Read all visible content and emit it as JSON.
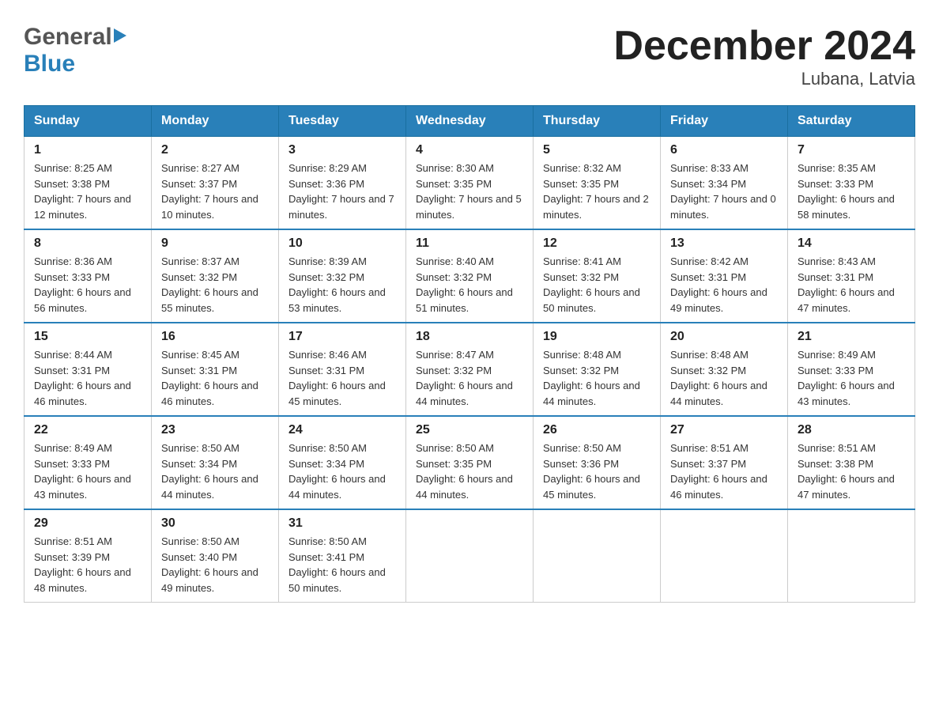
{
  "header": {
    "logo_general": "General",
    "logo_blue": "Blue",
    "title": "December 2024",
    "subtitle": "Lubana, Latvia"
  },
  "calendar": {
    "days_of_week": [
      "Sunday",
      "Monday",
      "Tuesday",
      "Wednesday",
      "Thursday",
      "Friday",
      "Saturday"
    ],
    "weeks": [
      [
        {
          "day": "1",
          "sunrise": "8:25 AM",
          "sunset": "3:38 PM",
          "daylight": "7 hours and 12 minutes."
        },
        {
          "day": "2",
          "sunrise": "8:27 AM",
          "sunset": "3:37 PM",
          "daylight": "7 hours and 10 minutes."
        },
        {
          "day": "3",
          "sunrise": "8:29 AM",
          "sunset": "3:36 PM",
          "daylight": "7 hours and 7 minutes."
        },
        {
          "day": "4",
          "sunrise": "8:30 AM",
          "sunset": "3:35 PM",
          "daylight": "7 hours and 5 minutes."
        },
        {
          "day": "5",
          "sunrise": "8:32 AM",
          "sunset": "3:35 PM",
          "daylight": "7 hours and 2 minutes."
        },
        {
          "day": "6",
          "sunrise": "8:33 AM",
          "sunset": "3:34 PM",
          "daylight": "7 hours and 0 minutes."
        },
        {
          "day": "7",
          "sunrise": "8:35 AM",
          "sunset": "3:33 PM",
          "daylight": "6 hours and 58 minutes."
        }
      ],
      [
        {
          "day": "8",
          "sunrise": "8:36 AM",
          "sunset": "3:33 PM",
          "daylight": "6 hours and 56 minutes."
        },
        {
          "day": "9",
          "sunrise": "8:37 AM",
          "sunset": "3:32 PM",
          "daylight": "6 hours and 55 minutes."
        },
        {
          "day": "10",
          "sunrise": "8:39 AM",
          "sunset": "3:32 PM",
          "daylight": "6 hours and 53 minutes."
        },
        {
          "day": "11",
          "sunrise": "8:40 AM",
          "sunset": "3:32 PM",
          "daylight": "6 hours and 51 minutes."
        },
        {
          "day": "12",
          "sunrise": "8:41 AM",
          "sunset": "3:32 PM",
          "daylight": "6 hours and 50 minutes."
        },
        {
          "day": "13",
          "sunrise": "8:42 AM",
          "sunset": "3:31 PM",
          "daylight": "6 hours and 49 minutes."
        },
        {
          "day": "14",
          "sunrise": "8:43 AM",
          "sunset": "3:31 PM",
          "daylight": "6 hours and 47 minutes."
        }
      ],
      [
        {
          "day": "15",
          "sunrise": "8:44 AM",
          "sunset": "3:31 PM",
          "daylight": "6 hours and 46 minutes."
        },
        {
          "day": "16",
          "sunrise": "8:45 AM",
          "sunset": "3:31 PM",
          "daylight": "6 hours and 46 minutes."
        },
        {
          "day": "17",
          "sunrise": "8:46 AM",
          "sunset": "3:31 PM",
          "daylight": "6 hours and 45 minutes."
        },
        {
          "day": "18",
          "sunrise": "8:47 AM",
          "sunset": "3:32 PM",
          "daylight": "6 hours and 44 minutes."
        },
        {
          "day": "19",
          "sunrise": "8:48 AM",
          "sunset": "3:32 PM",
          "daylight": "6 hours and 44 minutes."
        },
        {
          "day": "20",
          "sunrise": "8:48 AM",
          "sunset": "3:32 PM",
          "daylight": "6 hours and 44 minutes."
        },
        {
          "day": "21",
          "sunrise": "8:49 AM",
          "sunset": "3:33 PM",
          "daylight": "6 hours and 43 minutes."
        }
      ],
      [
        {
          "day": "22",
          "sunrise": "8:49 AM",
          "sunset": "3:33 PM",
          "daylight": "6 hours and 43 minutes."
        },
        {
          "day": "23",
          "sunrise": "8:50 AM",
          "sunset": "3:34 PM",
          "daylight": "6 hours and 44 minutes."
        },
        {
          "day": "24",
          "sunrise": "8:50 AM",
          "sunset": "3:34 PM",
          "daylight": "6 hours and 44 minutes."
        },
        {
          "day": "25",
          "sunrise": "8:50 AM",
          "sunset": "3:35 PM",
          "daylight": "6 hours and 44 minutes."
        },
        {
          "day": "26",
          "sunrise": "8:50 AM",
          "sunset": "3:36 PM",
          "daylight": "6 hours and 45 minutes."
        },
        {
          "day": "27",
          "sunrise": "8:51 AM",
          "sunset": "3:37 PM",
          "daylight": "6 hours and 46 minutes."
        },
        {
          "day": "28",
          "sunrise": "8:51 AM",
          "sunset": "3:38 PM",
          "daylight": "6 hours and 47 minutes."
        }
      ],
      [
        {
          "day": "29",
          "sunrise": "8:51 AM",
          "sunset": "3:39 PM",
          "daylight": "6 hours and 48 minutes."
        },
        {
          "day": "30",
          "sunrise": "8:50 AM",
          "sunset": "3:40 PM",
          "daylight": "6 hours and 49 minutes."
        },
        {
          "day": "31",
          "sunrise": "8:50 AM",
          "sunset": "3:41 PM",
          "daylight": "6 hours and 50 minutes."
        },
        null,
        null,
        null,
        null
      ]
    ]
  }
}
